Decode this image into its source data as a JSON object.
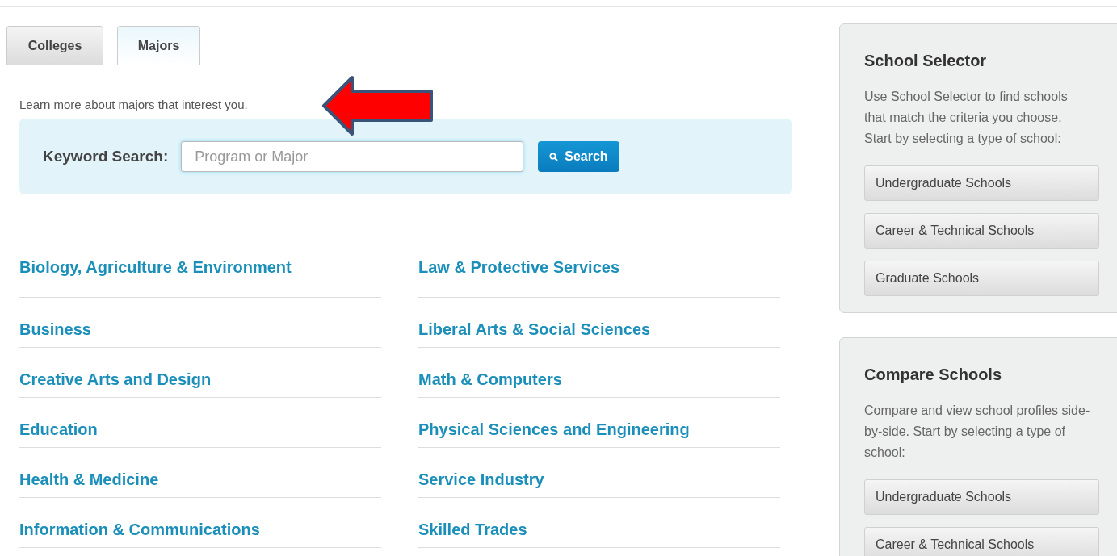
{
  "tabs": [
    {
      "label": "Colleges",
      "selected": false
    },
    {
      "label": "Majors",
      "selected": true
    }
  ],
  "intro": "Learn more about majors that interest you.",
  "search": {
    "label": "Keyword Search:",
    "placeholder": "Program or Major",
    "button": "Search"
  },
  "majors": [
    [
      "Biology, Agriculture & Environment",
      "Business",
      "Creative Arts and Design",
      "Education",
      "Health & Medicine",
      "Information & Communications"
    ],
    [
      "Law & Protective Services",
      "Liberal Arts & Social Sciences",
      "Math & Computers",
      "Physical Sciences and Engineering",
      "Service Industry",
      "Skilled Trades"
    ]
  ],
  "sidebar": [
    {
      "title": "School Selector",
      "text": "Use School Selector to find schools that match the criteria you choose. Start by selecting a type of school:",
      "buttons": [
        "Undergraduate Schools",
        "Career & Technical Schools",
        "Graduate Schools"
      ]
    },
    {
      "title": "Compare Schools",
      "text": "Compare and view school profiles side-by-side. Start by selecting a type of school:",
      "buttons": [
        "Undergraduate Schools",
        "Career & Technical Schools"
      ]
    }
  ]
}
